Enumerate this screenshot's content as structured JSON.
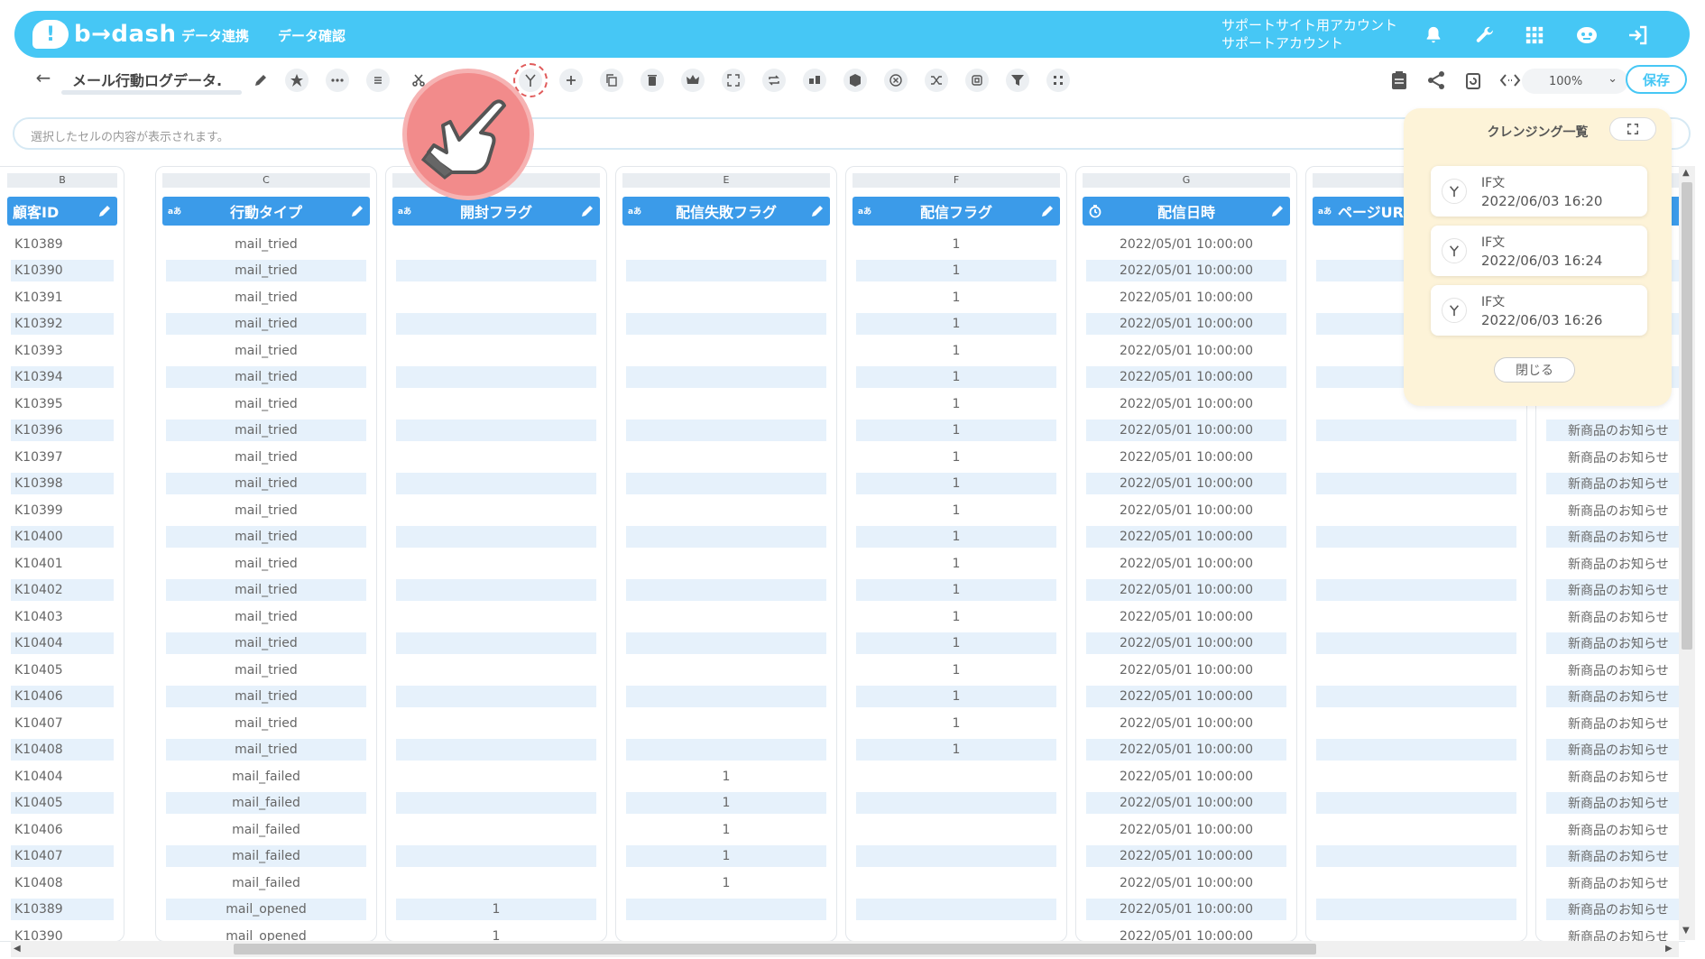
{
  "app": {
    "brand": "b→dash",
    "logo_mark": "!"
  },
  "nav": {
    "link1": "データ連携",
    "link2": "データ確認"
  },
  "account": {
    "line1": "サポートサイト用アカウント",
    "line2": "サポートアカウント"
  },
  "toolbar": {
    "title": "メール行動ログデータ.",
    "zoom": "100%",
    "save": "保存"
  },
  "cellbar": {
    "placeholder": "選択したセルの内容が表示されます。"
  },
  "columns": [
    {
      "letter": "B",
      "header": "顧客ID",
      "type_tag": ""
    },
    {
      "letter": "C",
      "header": "行動タイプ",
      "type_tag": "aあ"
    },
    {
      "letter": "",
      "header": "開封フラグ",
      "type_tag": "aあ"
    },
    {
      "letter": "E",
      "header": "配信失敗フラグ",
      "type_tag": "aあ"
    },
    {
      "letter": "F",
      "header": "配信フラグ",
      "type_tag": "aあ"
    },
    {
      "letter": "G",
      "header": "配信日時",
      "type_tag": "clock"
    },
    {
      "letter": "",
      "header": "ページUR",
      "type_tag": "aあ"
    },
    {
      "letter": "",
      "header": "",
      "type_tag": ""
    }
  ],
  "rows": {
    "customer_id": [
      "K10389",
      "K10390",
      "K10391",
      "K10392",
      "K10393",
      "K10394",
      "K10395",
      "K10396",
      "K10397",
      "K10398",
      "K10399",
      "K10400",
      "K10401",
      "K10402",
      "K10403",
      "K10404",
      "K10405",
      "K10406",
      "K10407",
      "K10408",
      "K10404",
      "K10405",
      "K10406",
      "K10407",
      "K10408",
      "K10389",
      "K10390"
    ],
    "action_type": [
      "mail_tried",
      "mail_tried",
      "mail_tried",
      "mail_tried",
      "mail_tried",
      "mail_tried",
      "mail_tried",
      "mail_tried",
      "mail_tried",
      "mail_tried",
      "mail_tried",
      "mail_tried",
      "mail_tried",
      "mail_tried",
      "mail_tried",
      "mail_tried",
      "mail_tried",
      "mail_tried",
      "mail_tried",
      "mail_tried",
      "mail_failed",
      "mail_failed",
      "mail_failed",
      "mail_failed",
      "mail_failed",
      "mail_opened",
      "mail_opened"
    ],
    "open_flag": [
      "",
      "",
      "",
      "",
      "",
      "",
      "",
      "",
      "",
      "",
      "",
      "",
      "",
      "",
      "",
      "",
      "",
      "",
      "",
      "",
      "",
      "",
      "",
      "",
      "",
      "1",
      "1"
    ],
    "fail_flag": [
      "",
      "",
      "",
      "",
      "",
      "",
      "",
      "",
      "",
      "",
      "",
      "",
      "",
      "",
      "",
      "",
      "",
      "",
      "",
      "",
      "1",
      "1",
      "1",
      "1",
      "1",
      "",
      ""
    ],
    "sent_flag": [
      "1",
      "1",
      "1",
      "1",
      "1",
      "1",
      "1",
      "1",
      "1",
      "1",
      "1",
      "1",
      "1",
      "1",
      "1",
      "1",
      "1",
      "1",
      "1",
      "1",
      "",
      "",
      "",
      "",
      "",
      "",
      ""
    ],
    "sent_at": "2022/05/01 10:00:00",
    "page_url": "",
    "news_from_row": 7,
    "news_text": "新商品のお知らせ"
  },
  "panel": {
    "title": "クレンジング一覧",
    "items": [
      {
        "type": "IF文",
        "date": "2022/06/03 16:20"
      },
      {
        "type": "IF文",
        "date": "2022/06/03 16:24"
      },
      {
        "type": "IF文",
        "date": "2022/06/03 16:26"
      }
    ],
    "close": "閉じる"
  },
  "colors": {
    "brand": "#46c7f5",
    "header": "#3b9be9",
    "row_alt": "#e6f1fb",
    "panel_bg": "#fdf3d8",
    "pointer": "#f28b8b"
  },
  "icons": [
    "bell-icon",
    "wrench-icon",
    "apps-grid-icon",
    "robot-icon",
    "logout-icon",
    "star-icon",
    "more-icon",
    "list-icon",
    "scissors-icon",
    "branch-icon",
    "plus-icon",
    "copy-icon",
    "trash-icon",
    "crown-icon",
    "expand-icon",
    "repeat-icon",
    "split-icon",
    "box-icon",
    "close-circle-icon",
    "shuffle-icon",
    "frame-icon",
    "filter-icon",
    "grid-dots-icon",
    "clipboard-icon",
    "share-icon",
    "refresh-icon",
    "code-icon"
  ]
}
